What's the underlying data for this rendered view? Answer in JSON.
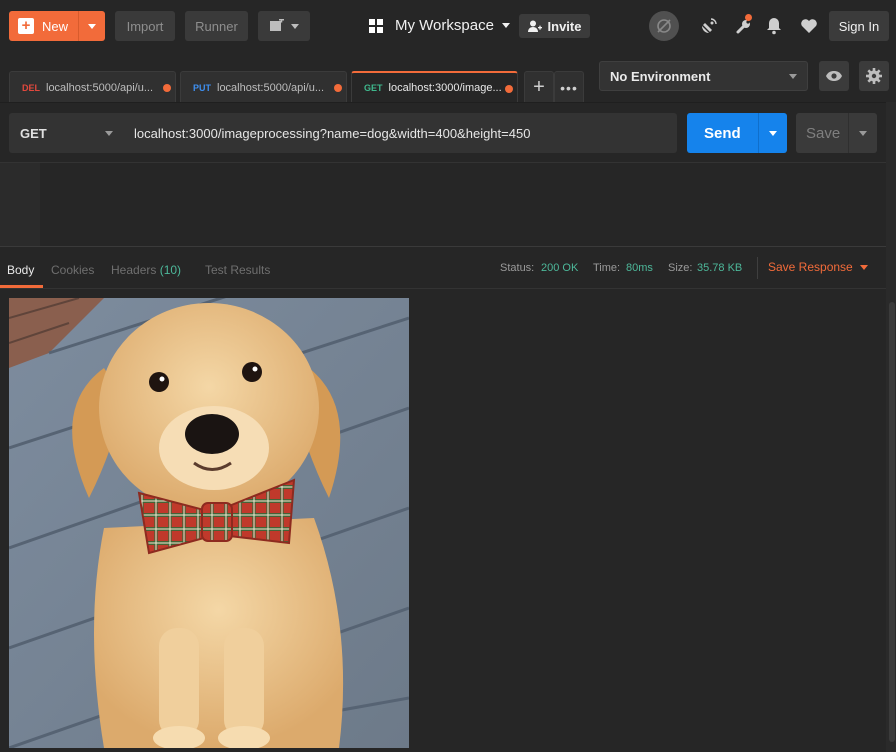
{
  "header": {
    "new_label": "New",
    "import_label": "Import",
    "runner_label": "Runner",
    "workspace_label": "My Workspace",
    "invite_label": "Invite",
    "signin_label": "Sign In"
  },
  "tabs": [
    {
      "method": "DEL",
      "label": "localhost:5000/api/u...",
      "method_color": "#e2483d"
    },
    {
      "method": "PUT",
      "label": "localhost:5000/api/u...",
      "method_color": "#3e8ff0"
    },
    {
      "method": "GET",
      "label": "localhost:3000/image...",
      "method_color": "#3fb78c",
      "active": true
    }
  ],
  "environment": {
    "selected": "No Environment"
  },
  "request": {
    "method": "GET",
    "url": "localhost:3000/imageprocessing?name=dog&width=400&height=450",
    "send_label": "Send",
    "save_label": "Save"
  },
  "response": {
    "tabs": {
      "body": "Body",
      "cookies": "Cookies",
      "headers": "Headers",
      "headers_count": "(10)",
      "tests": "Test Results"
    },
    "status_label": "Status:",
    "status_value": "200 OK",
    "time_label": "Time:",
    "time_value": "80ms",
    "size_label": "Size:",
    "size_value": "35.78 KB",
    "save_response": "Save Response"
  },
  "colors": {
    "accent": "#f26b3a",
    "send": "#1583ec",
    "status_green": "#4db89a"
  },
  "icons": [
    "plus-icon",
    "chevron-down-icon",
    "grid-icon",
    "add-user-icon",
    "sync-off-icon",
    "satellite-icon",
    "wrench-icon",
    "bell-icon",
    "heart-icon",
    "eye-icon",
    "gear-icon",
    "more-icon"
  ]
}
